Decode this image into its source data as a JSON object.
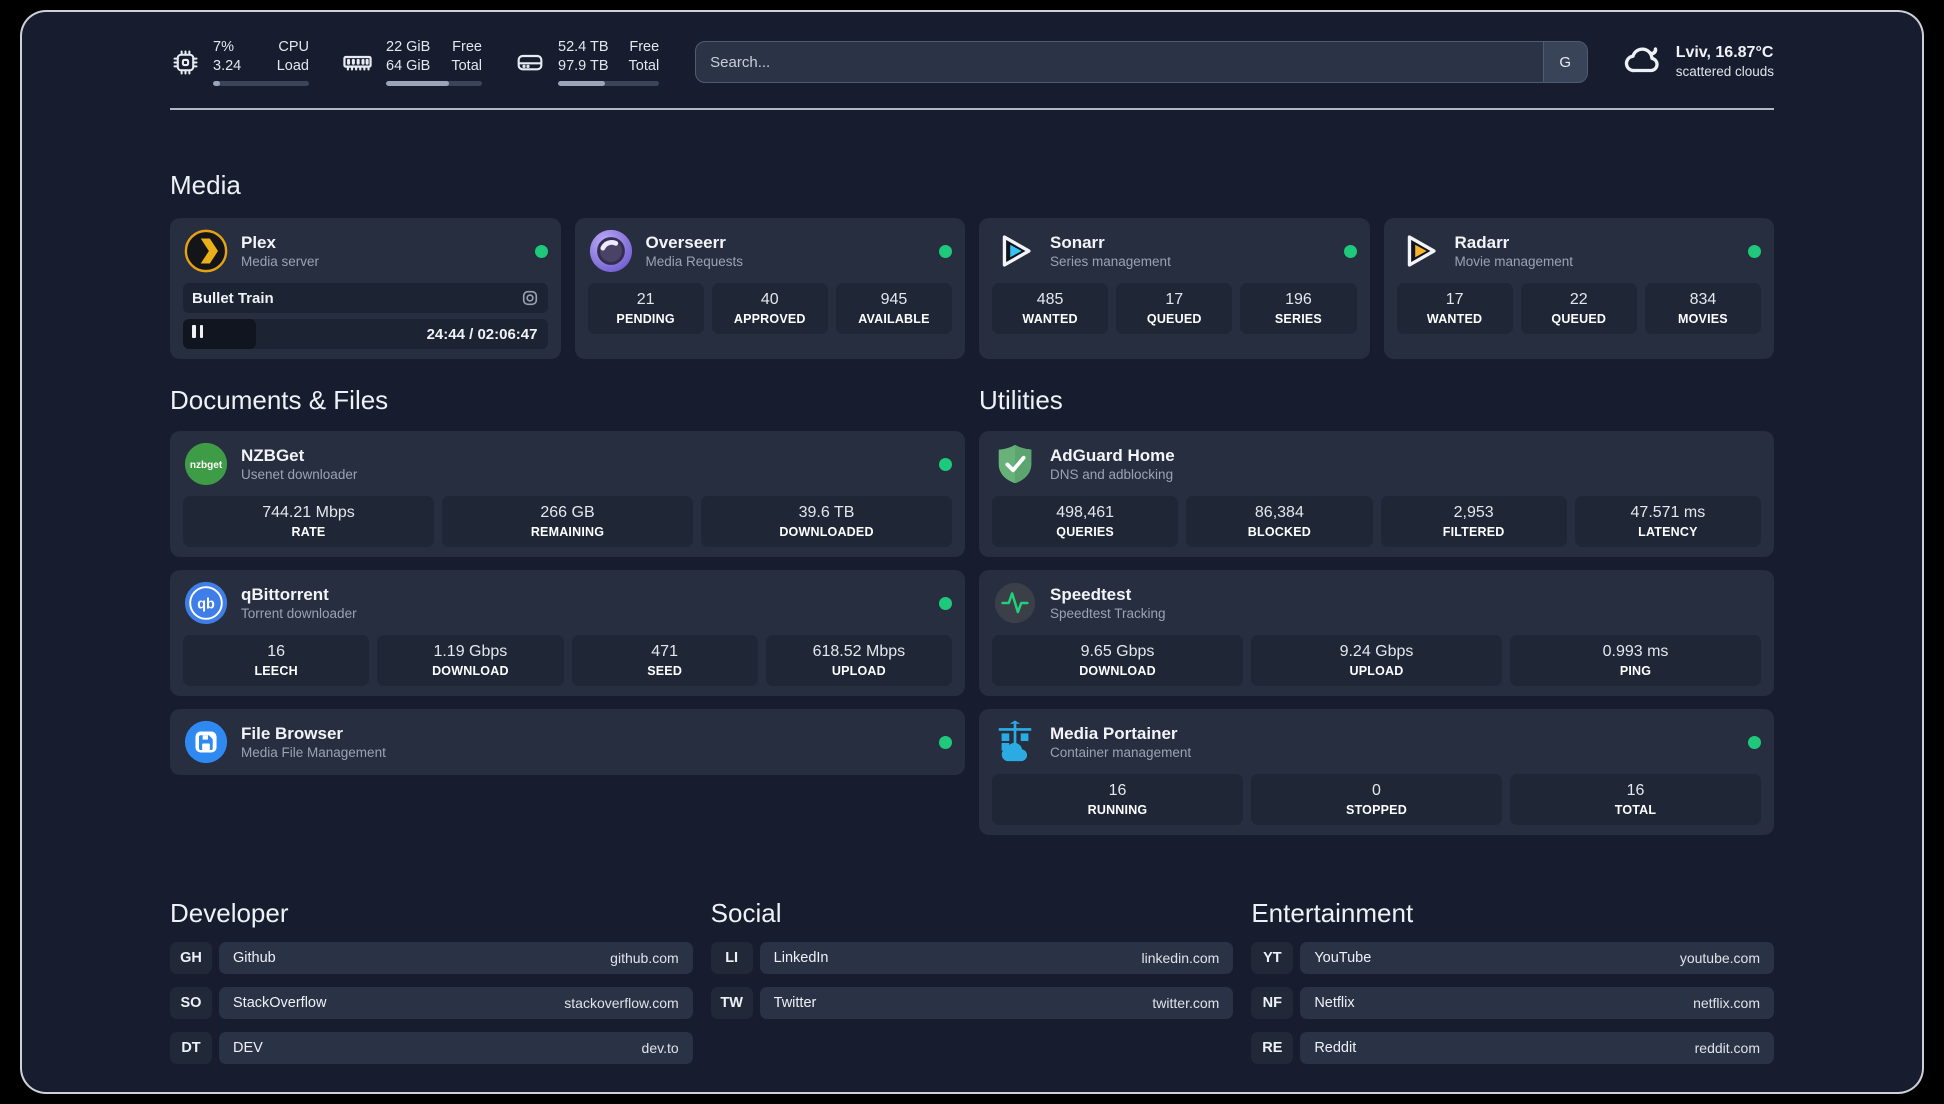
{
  "colors": {
    "background": "#171d2e",
    "card": "#272e3f",
    "stat_box": "#1f2737",
    "status_online": "#1ec97b",
    "plex_amber": "#e7a213",
    "sonarr_blue": "#38c3f1",
    "radarr_yellow": "#f7b32b",
    "portainer_blue": "#2cabe3",
    "adguard_green": "#68b279"
  },
  "header": {
    "stats": [
      {
        "icon": "cpu-icon",
        "line1": "7%",
        "label1": "CPU",
        "line2": "3.24",
        "label2": "Load",
        "progress_pct": 7
      },
      {
        "icon": "memory-icon",
        "line1": "22 GiB",
        "label1": "Free",
        "line2": "64 GiB",
        "label2": "Total",
        "progress_pct": 66
      },
      {
        "icon": "disk-icon",
        "line1": "52.4 TB",
        "label1": "Free",
        "line2": "97.9 TB",
        "label2": "Total",
        "progress_pct": 46
      }
    ],
    "search": {
      "placeholder": "Search...",
      "button": "G"
    },
    "weather": {
      "title": "Lviv, 16.87°C",
      "subtitle": "scattered clouds"
    }
  },
  "media": {
    "title": "Media",
    "plex": {
      "name": "Plex",
      "desc": "Media server",
      "online": true,
      "now_playing": "Bullet Train",
      "time": "24:44 / 02:06:47",
      "progress_pct": 20
    },
    "overseerr": {
      "name": "Overseerr",
      "desc": "Media Requests",
      "online": true,
      "stats": [
        {
          "value": "21",
          "label": "PENDING"
        },
        {
          "value": "40",
          "label": "APPROVED"
        },
        {
          "value": "945",
          "label": "AVAILABLE"
        }
      ]
    },
    "sonarr": {
      "name": "Sonarr",
      "desc": "Series management",
      "online": true,
      "stats": [
        {
          "value": "485",
          "label": "WANTED"
        },
        {
          "value": "17",
          "label": "QUEUED"
        },
        {
          "value": "196",
          "label": "SERIES"
        }
      ]
    },
    "radarr": {
      "name": "Radarr",
      "desc": "Movie management",
      "online": true,
      "stats": [
        {
          "value": "17",
          "label": "WANTED"
        },
        {
          "value": "22",
          "label": "QUEUED"
        },
        {
          "value": "834",
          "label": "MOVIES"
        }
      ]
    }
  },
  "documents": {
    "title": "Documents & Files",
    "nzbget": {
      "name": "NZBGet",
      "desc": "Usenet downloader",
      "online": true,
      "icon_text": "nzbget",
      "stats": [
        {
          "value": "744.21 Mbps",
          "label": "RATE"
        },
        {
          "value": "266 GB",
          "label": "REMAINING"
        },
        {
          "value": "39.6 TB",
          "label": "DOWNLOADED"
        }
      ]
    },
    "qbittorrent": {
      "name": "qBittorrent",
      "desc": "Torrent downloader",
      "online": true,
      "icon_text": "qb",
      "stats": [
        {
          "value": "16",
          "label": "LEECH"
        },
        {
          "value": "1.19 Gbps",
          "label": "DOWNLOAD"
        },
        {
          "value": "471",
          "label": "SEED"
        },
        {
          "value": "618.52 Mbps",
          "label": "UPLOAD"
        }
      ]
    },
    "filebrowser": {
      "name": "File Browser",
      "desc": "Media File Management",
      "online": true
    }
  },
  "utilities": {
    "title": "Utilities",
    "adguard": {
      "name": "AdGuard Home",
      "desc": "DNS and adblocking",
      "online": false,
      "stats": [
        {
          "value": "498,461",
          "label": "QUERIES"
        },
        {
          "value": "86,384",
          "label": "BLOCKED"
        },
        {
          "value": "2,953",
          "label": "FILTERED"
        },
        {
          "value": "47.571 ms",
          "label": "LATENCY"
        }
      ]
    },
    "speedtest": {
      "name": "Speedtest",
      "desc": "Speedtest Tracking",
      "online": false,
      "stats": [
        {
          "value": "9.65 Gbps",
          "label": "DOWNLOAD"
        },
        {
          "value": "9.24 Gbps",
          "label": "UPLOAD"
        },
        {
          "value": "0.993 ms",
          "label": "PING"
        }
      ]
    },
    "portainer": {
      "name": "Media Portainer",
      "desc": "Container management",
      "online": true,
      "stats": [
        {
          "value": "16",
          "label": "RUNNING"
        },
        {
          "value": "0",
          "label": "STOPPED"
        },
        {
          "value": "16",
          "label": "TOTAL"
        }
      ]
    }
  },
  "links": {
    "developer": {
      "title": "Developer",
      "items": [
        {
          "tag": "GH",
          "name": "Github",
          "url": "github.com"
        },
        {
          "tag": "SO",
          "name": "StackOverflow",
          "url": "stackoverflow.com"
        },
        {
          "tag": "DT",
          "name": "DEV",
          "url": "dev.to"
        }
      ]
    },
    "social": {
      "title": "Social",
      "items": [
        {
          "tag": "LI",
          "name": "LinkedIn",
          "url": "linkedin.com"
        },
        {
          "tag": "TW",
          "name": "Twitter",
          "url": "twitter.com"
        }
      ]
    },
    "entertainment": {
      "title": "Entertainment",
      "items": [
        {
          "tag": "YT",
          "name": "YouTube",
          "url": "youtube.com"
        },
        {
          "tag": "NF",
          "name": "Netflix",
          "url": "netflix.com"
        },
        {
          "tag": "RE",
          "name": "Reddit",
          "url": "reddit.com"
        }
      ]
    }
  }
}
